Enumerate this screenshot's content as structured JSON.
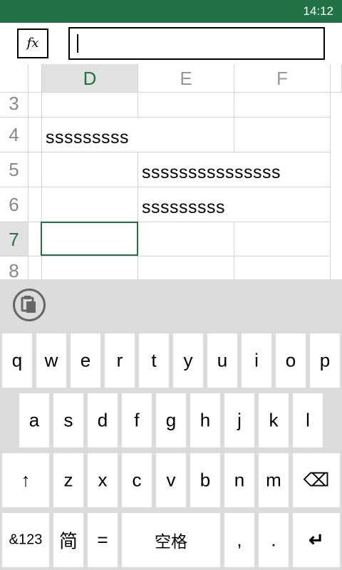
{
  "status": {
    "time": "14:12"
  },
  "formula": {
    "fx_label": "fx",
    "value": ""
  },
  "columns": [
    {
      "label": "D",
      "active": true
    },
    {
      "label": "E",
      "active": false
    },
    {
      "label": "F",
      "active": false
    }
  ],
  "rows": [
    {
      "label": "3",
      "active": false
    },
    {
      "label": "4",
      "active": false
    },
    {
      "label": "5",
      "active": false
    },
    {
      "label": "6",
      "active": false
    },
    {
      "label": "7",
      "active": true
    },
    {
      "label": "8",
      "active": false
    }
  ],
  "cells": {
    "D4": "sssssssss",
    "E5": "sssssssssssssss",
    "E6": "sssssssss"
  },
  "selection": "D7",
  "keyboard": {
    "row1": [
      "q",
      "w",
      "e",
      "r",
      "t",
      "y",
      "u",
      "i",
      "o",
      "p"
    ],
    "row2": [
      "a",
      "s",
      "d",
      "f",
      "g",
      "h",
      "j",
      "k",
      "l"
    ],
    "row3": [
      "z",
      "x",
      "c",
      "v",
      "b",
      "n",
      "m"
    ],
    "shift": "↑",
    "backspace": "⌫",
    "num": "&123",
    "lang": "简",
    "equals": "=",
    "space": "空格",
    "comma": ",",
    "period": ".",
    "enter": "↵"
  },
  "colors": {
    "accent": "#217346",
    "keyboard_bg": "#dcdcdc"
  }
}
